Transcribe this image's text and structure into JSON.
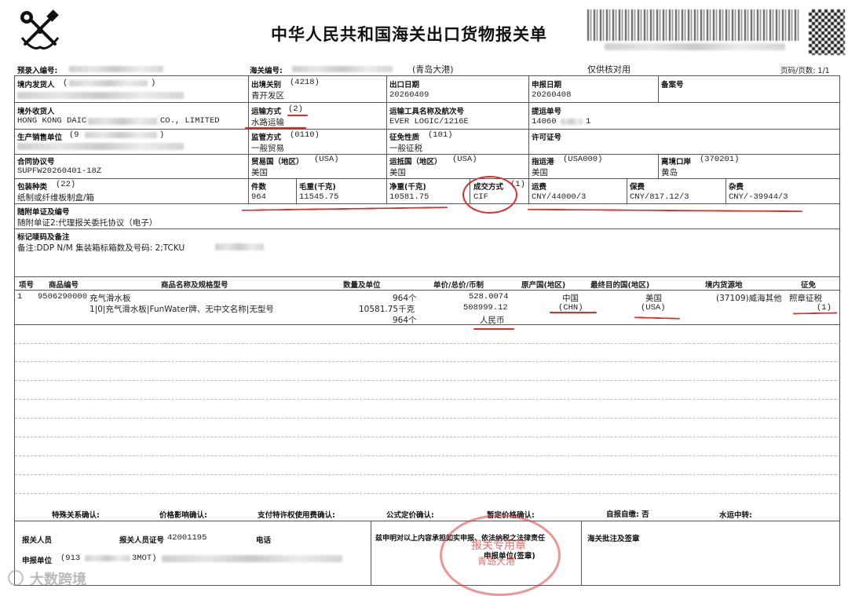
{
  "header": {
    "title": "中华人民共和国海关出口货物报关单",
    "preentry_label": "预录入编号:",
    "customs_no_label": "海关编号:",
    "port_name": "(青岛大港)",
    "note": "仅供核对用",
    "page_label": "页码/页数: 1/1"
  },
  "fields": {
    "domestic_consignor": {
      "label": "境内发货人",
      "value_prefix": "(",
      "value_suffix": ")"
    },
    "exit_customs": {
      "label": "出境关别",
      "code": "(4218)",
      "value": "青开发区"
    },
    "export_date": {
      "label": "出口日期",
      "value": "20260409"
    },
    "declare_date": {
      "label": "申报日期",
      "value": "20260408"
    },
    "record_no": {
      "label": "备案号",
      "value": ""
    },
    "overseas_consignee": {
      "label": "境外收货人",
      "value_start": "HONG KONG DAIC",
      "value_end": "CO., LIMITED"
    },
    "transport_mode": {
      "label": "运输方式",
      "code": "(2)",
      "value": "水路运输"
    },
    "transport_tool": {
      "label": "运输工具名称及航次号",
      "value": "EVER LOGIC/1216E"
    },
    "bill_no": {
      "label": "提运单号",
      "value_start": "14060",
      "value_end": "1"
    },
    "producer": {
      "label": "生产销售单位",
      "value_prefix": "(9",
      "value_suffix": ")"
    },
    "supervision": {
      "label": "监管方式",
      "code": "(0110)",
      "value": "一般贸易"
    },
    "levy_nature": {
      "label": "征免性质",
      "code": "(101)",
      "value": "一般征税"
    },
    "license_no": {
      "label": "许可证号",
      "value": ""
    },
    "contract_no": {
      "label": "合同协议号",
      "value": "SUPFW20260401-18Z"
    },
    "trade_country": {
      "label": "贸易国（地区）",
      "code": "(USA)",
      "value": "美国"
    },
    "dest_country": {
      "label": "运抵国（地区）",
      "code": "(USA)",
      "value": "美国"
    },
    "dest_port": {
      "label": "指运港",
      "code": "(USA000)",
      "value": "美国"
    },
    "exit_port": {
      "label": "离境口岸",
      "code": "(370201)",
      "value": "黄岛"
    },
    "package_type": {
      "label": "包装种类",
      "code": "(22)",
      "value": "纸制或纤维板制盒/箱"
    },
    "pieces": {
      "label": "件数",
      "value": "964"
    },
    "gross_weight": {
      "label": "毛重(千克)",
      "value": "11545.75"
    },
    "net_weight": {
      "label": "净重(千克)",
      "value": "10581.75"
    },
    "trade_terms": {
      "label": "成交方式",
      "code": "(1)",
      "value": "CIF"
    },
    "freight": {
      "label": "运费",
      "value": "CNY/44000/3"
    },
    "insurance": {
      "label": "保费",
      "value": "CNY/817.12/3"
    },
    "misc_fee": {
      "label": "杂费",
      "value": "CNY/-39944/3"
    },
    "attached_docs": {
      "label": "随附单证及编号",
      "value": "随附单证2:代理报关委托协议（电子）"
    },
    "marks": {
      "label": "标记唛码及备注",
      "value": "备注:DDP N/M  集装箱标箱数及号码: 2;TCKU"
    }
  },
  "goods": {
    "headers": [
      "项号",
      "商品编号",
      "商品名称及规格型号",
      "数量及单位",
      "单价/总价/币制",
      "原产国(地区)",
      "最终目的国(地区)",
      "境内货源地",
      "征免"
    ],
    "rows": [
      {
        "item_no": "1",
        "hs_code": "9506290000",
        "name": "充气滑水板",
        "spec": "1|0|充气滑水板|FunWater牌、无中文名称|无型号",
        "qty1": "964个",
        "qty2": "10581.75千克",
        "qty3": "964个",
        "unit_price": "528.0074",
        "total_price": "508999.12",
        "currency": "人民币",
        "origin": "中国",
        "origin_code": "(CHN)",
        "dest": "美国",
        "dest_code": "(USA)",
        "source": "(37109)威海其他",
        "levy": "照章征税",
        "levy_code": "(1)"
      }
    ]
  },
  "confirmations": {
    "special_relation": "特殊关系确认:",
    "price_influence": "价格影响确认:",
    "royalty": "支付特许权使用费确认:",
    "formula_price": "公式定价确认:",
    "provisional_price": "暂定价格确认:",
    "self_report": "自报自缴: 否",
    "water_transit": "水运中转:"
  },
  "footer": {
    "declarer_label": "报关人员",
    "declarer_cert_label": "报关人员证号",
    "declarer_cert_no": "42001195",
    "phone_label": "电话",
    "statement": "兹申明对以上内容承担如实申报、依法纳税之法律责任",
    "customs_remarks": "海关批注及签章",
    "declare_unit_label": "申报单位",
    "declare_unit_value_start": "(913",
    "declare_unit_value_end": "3MOT)",
    "declare_unit_sign": "申报单位(签章)",
    "stamp_text_1": "报关专用章",
    "stamp_text_2": "青岛大港"
  },
  "watermark": {
    "text": "大数跨境"
  },
  "colors": {
    "annotation_red": "#e12b2b",
    "stamp_red": "#dc3232",
    "border": "#555555"
  }
}
